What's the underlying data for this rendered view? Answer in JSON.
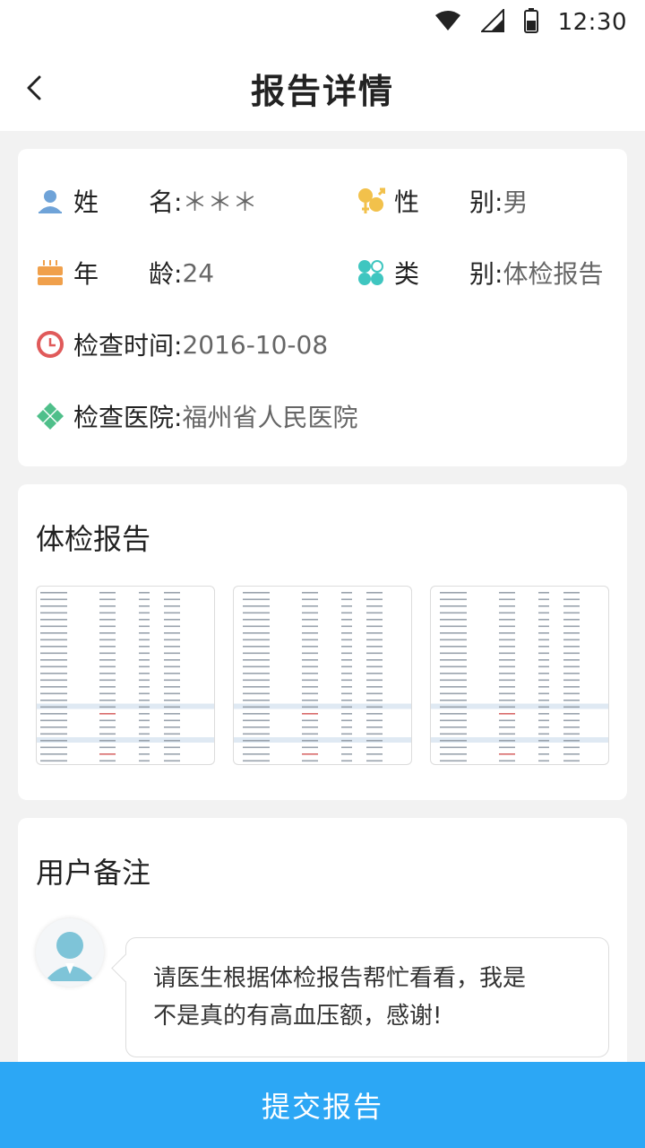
{
  "status_bar": {
    "time": "12:30"
  },
  "nav": {
    "title": "报告详情"
  },
  "info": {
    "name_label_a": "姓",
    "name_label_b": "名:",
    "name_value": "＊＊＊",
    "gender_label_a": "性",
    "gender_label_b": "别:",
    "gender_value": "男",
    "age_label_a": "年",
    "age_label_b": "龄:",
    "age_value": "24",
    "category_label_a": "类",
    "category_label_b": "别:",
    "category_value": "体检报告",
    "date_label": "检查时间:",
    "date_value": "2016-10-08",
    "hospital_label": "检查医院:",
    "hospital_value": "福州省人民医院"
  },
  "report": {
    "title": "体检报告",
    "thumbnails": [
      "report-image-1",
      "report-image-2",
      "report-image-3"
    ]
  },
  "note": {
    "title": "用户备注",
    "line1": "请医生根据体检报告帮忙看看，我是",
    "line2": "不是真的有高血压额，感谢!"
  },
  "footer": {
    "submit_label": "提交报告"
  },
  "colors": {
    "accent": "#2ca7f5",
    "icon_name": "#6fa3d8",
    "icon_gender": "#f2c14b",
    "icon_age": "#f0a04b",
    "icon_category": "#3fc6c0",
    "icon_time": "#e05a5a",
    "icon_hospital": "#4fbf8a"
  },
  "icons": {
    "wifi": "wifi-icon",
    "signal": "signal-icon",
    "battery": "battery-icon",
    "back": "back-arrow-icon",
    "name": "person-icon",
    "gender": "gender-icon",
    "age": "cake-icon",
    "category": "category-icon",
    "time": "clock-icon",
    "hospital": "hospital-icon",
    "avatar": "user-avatar-icon"
  }
}
